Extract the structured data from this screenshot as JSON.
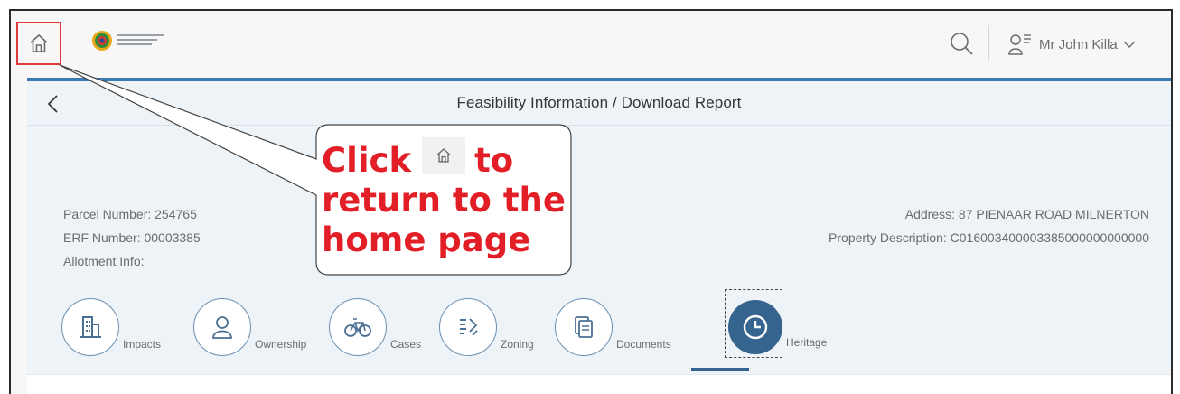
{
  "shell": {
    "logo_text": "CITY OF CAPE TOWN",
    "user_name": "Mr John Killa"
  },
  "page": {
    "title": "Feasibility Information / Download Report"
  },
  "info": {
    "parcel": "Parcel Number: 254765",
    "erf": "ERF Number: 00003385",
    "allotment": "Allotment Info:",
    "address": "Address: 87 PIENAAR ROAD MILNERTON",
    "property": "Property Description: C016003400003385000000000000"
  },
  "tabs": [
    {
      "label": "Impacts",
      "icon": "building-icon"
    },
    {
      "label": "Ownership",
      "icon": "person-icon"
    },
    {
      "label": "Cases",
      "icon": "bicycle-icon"
    },
    {
      "label": "Zoning",
      "icon": "zoning-icon"
    },
    {
      "label": "Documents",
      "icon": "documents-icon"
    },
    {
      "label": "Heritage",
      "icon": "clock-icon",
      "active": true
    }
  ],
  "callout": {
    "word1": "Click",
    "word2": "to",
    "line2": "return to the",
    "line3": "home page"
  },
  "colors": {
    "accent": "#35648f",
    "highlight": "#e0393a",
    "callout_text": "#e21f26"
  }
}
